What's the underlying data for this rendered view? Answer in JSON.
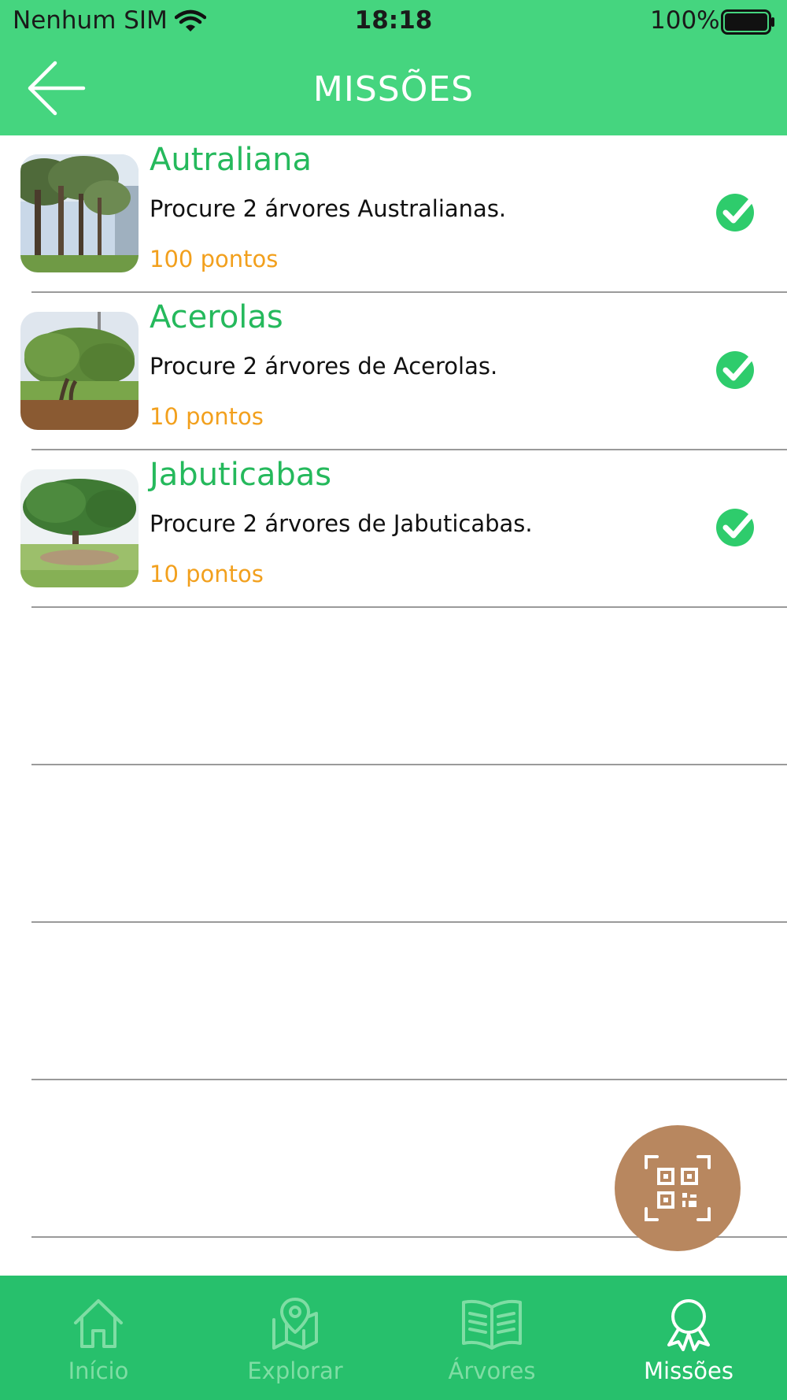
{
  "status_bar": {
    "carrier": "Nenhum SIM",
    "time": "18:18",
    "battery": "100%"
  },
  "header": {
    "title": "MISSÕES",
    "back_icon": "arrow-left-icon"
  },
  "missions": [
    {
      "title": "Autraliana",
      "description": "Procure 2 árvores Australianas.",
      "points": "100 pontos",
      "completed": true,
      "thumbnail": "eucalyptus-trees-photo"
    },
    {
      "title": "Acerolas",
      "description": "Procure 2 árvores de Acerolas.",
      "points": "10 pontos",
      "completed": true,
      "thumbnail": "acerola-tree-photo"
    },
    {
      "title": "Jabuticabas",
      "description": "Procure 2 árvores de Jabuticabas.",
      "points": "10 pontos",
      "completed": true,
      "thumbnail": "jabuticaba-tree-photo"
    }
  ],
  "empty_rows": 4,
  "fab": {
    "icon": "qr-code-scan-icon"
  },
  "tabs": [
    {
      "label": "Início",
      "icon": "home-icon",
      "active": false
    },
    {
      "label": "Explorar",
      "icon": "map-pin-icon",
      "active": false
    },
    {
      "label": "Árvores",
      "icon": "book-icon",
      "active": false
    },
    {
      "label": "Missões",
      "icon": "award-ribbon-icon",
      "active": true
    }
  ],
  "colors": {
    "header_green": "#45d57f",
    "tab_green": "#27c06c",
    "title_green": "#25b95c",
    "points_orange": "#f2a01d",
    "fab_brown": "#b8875f"
  }
}
